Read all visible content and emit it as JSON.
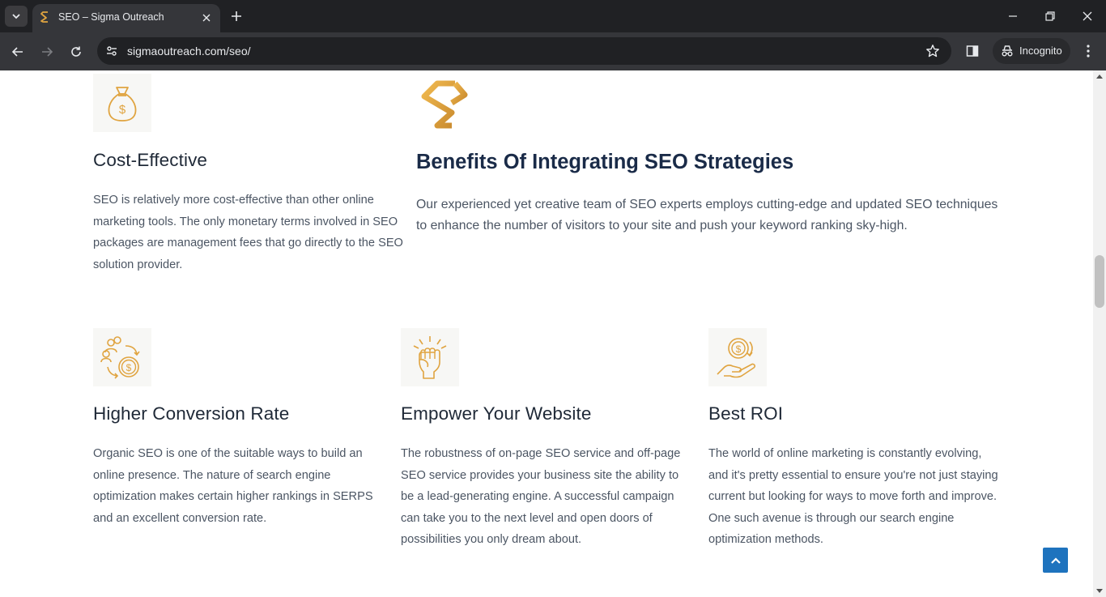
{
  "browser": {
    "tab_title": "SEO – Sigma Outreach",
    "url": "sigmaoutreach.com/seo/",
    "incognito_label": "Incognito"
  },
  "colors": {
    "accent_gold": "#e0a440",
    "heading_navy": "#1a2b48",
    "back_to_top": "#1e73be"
  },
  "page": {
    "cost_effective": {
      "icon": "money-bag-icon",
      "title": "Cost-Effective",
      "description": "SEO is relatively more cost-effective than other online marketing tools. The only monetary terms involved in SEO packages are management fees that go directly to the SEO solution provider."
    },
    "benefits": {
      "logo": "sigma-outreach-logo",
      "title": "Benefits Of Integrating SEO Strategies",
      "description": "Our experienced yet creative team of SEO experts employs cutting-edge and updated SEO techniques to enhance the number of visitors to your site and push your keyword ranking sky-high."
    },
    "features": [
      {
        "icon": "people-coin-cycle-icon",
        "title": "Higher Conversion Rate",
        "description": "Organic SEO is one of the suitable ways to build an online presence. The nature of search engine optimization makes certain higher rankings in SERPS and an excellent conversion rate."
      },
      {
        "icon": "raised-fist-icon",
        "title": "Empower Your Website",
        "description": "The robustness of on-page SEO service and off-page SEO service provides your business site the ability to be a lead-generating engine. A successful campaign can take you to the next level and open doors of possibilities you only dream about."
      },
      {
        "icon": "hand-coin-icon",
        "title": "Best ROI",
        "description": "The world of online marketing is constantly evolving, and it's pretty essential to ensure you're not just staying current but looking for ways to move forth and improve. One such avenue is through our search engine optimization methods."
      }
    ]
  }
}
